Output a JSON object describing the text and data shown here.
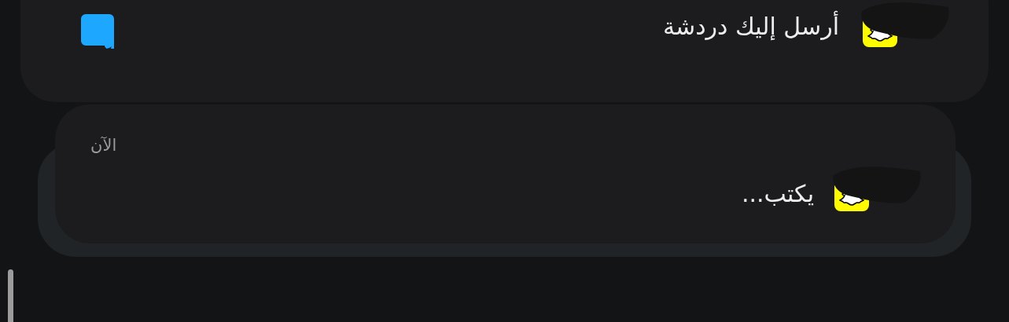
{
  "notifications": [
    {
      "message": "أرسل إليك دردشة",
      "stacked": false
    },
    {
      "time": "الآن",
      "message": "يكتب...",
      "stacked": true
    }
  ]
}
